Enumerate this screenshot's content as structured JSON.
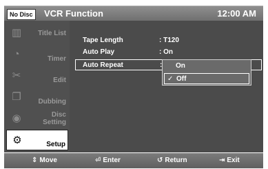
{
  "header": {
    "badge": "No Disc",
    "title": "VCR Function",
    "time": "12:00 AM"
  },
  "sidebar": {
    "items": [
      {
        "label_line1": "Title List",
        "label_line2": "",
        "icon": "film-icon"
      },
      {
        "label_line1": "Timer",
        "label_line2": "",
        "icon": "clock-icon"
      },
      {
        "label_line1": "Edit",
        "label_line2": "",
        "icon": "scissors-icon"
      },
      {
        "label_line1": "Dubbing",
        "label_line2": "",
        "icon": "copy-icon"
      },
      {
        "label_line1": "Disc",
        "label_line2": "Setting",
        "icon": "disc-icon"
      },
      {
        "label_line1": "Setup",
        "label_line2": "",
        "icon": "gear-icon"
      }
    ],
    "active_index": 5
  },
  "settings": {
    "rows": [
      {
        "name": "Tape Length",
        "value": ": T120"
      },
      {
        "name": "Auto Play",
        "value": ": On"
      },
      {
        "name": "Auto Repeat",
        "value": ":"
      }
    ]
  },
  "dropdown": {
    "options": [
      {
        "label": "On",
        "selected": false
      },
      {
        "label": "Off",
        "selected": true
      }
    ]
  },
  "footer": {
    "move": "Move",
    "enter": "Enter",
    "return": "Return",
    "exit": "Exit"
  }
}
